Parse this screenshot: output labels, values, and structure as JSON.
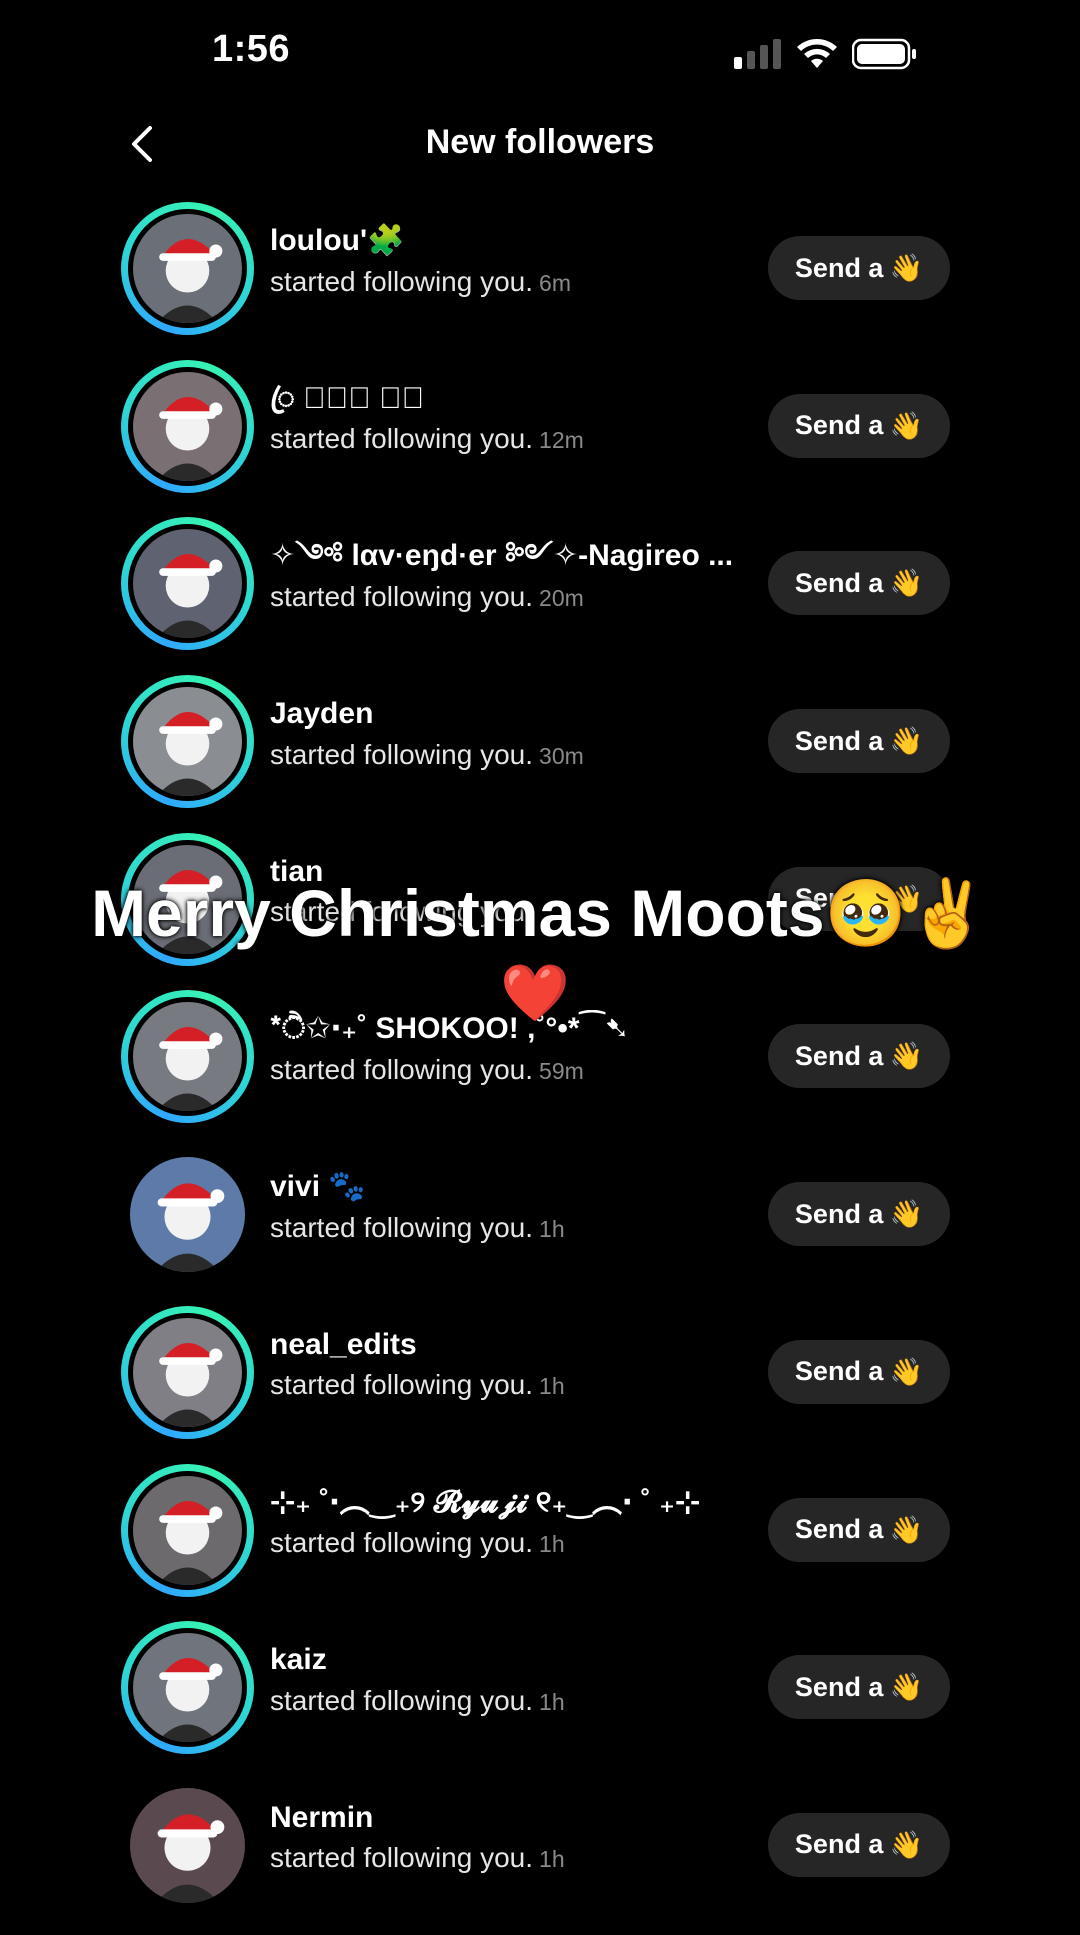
{
  "status_bar": {
    "time": "1:56",
    "icons": [
      "signal-icon",
      "wifi-icon",
      "battery-icon"
    ]
  },
  "nav": {
    "title": "New followers",
    "back_icon": "chevron-left-icon"
  },
  "send_label": "Send a",
  "send_emoji": "👋",
  "activity_text": "started following you.",
  "followers": [
    {
      "name": "loulou'🧩",
      "time": "6m",
      "story_ring": true
    },
    {
      "name": "ꦿ 𝓝𝓪𝓽 ⋆ꦿ",
      "time": "12m",
      "story_ring": true
    },
    {
      "name": "✧༺ lαv·eŋd·er ༻✧-Nagireo ...",
      "time": "20m",
      "story_ring": true
    },
    {
      "name": "Jayden",
      "time": "30m",
      "story_ring": true
    },
    {
      "name": "tian",
      "time": "",
      "story_ring": true
    },
    {
      "name": "*ੈ✩‧₊˚ SHOKOO! ,˚°•*⁀➷",
      "time": "59m",
      "story_ring": true
    },
    {
      "name": "vivi 🐾",
      "time": "1h",
      "story_ring": false
    },
    {
      "name": "neal_edits",
      "time": "1h",
      "story_ring": true
    },
    {
      "name": "⊹₊ ˚‧︵‿₊୨ 𝓡𝔂𝓾𝓳𝓲 ୧₊‿︵‧ ˚ ₊⊹",
      "time": "1h",
      "story_ring": true
    },
    {
      "name": "kaiz",
      "time": "1h",
      "story_ring": true
    },
    {
      "name": "Nermin",
      "time": "1h",
      "story_ring": false
    }
  ],
  "overlay": {
    "caption": "Merry Christmas Moots🥹✌️",
    "heart": "❤️"
  },
  "colors": {
    "background": "#000000",
    "button_bg": "#262626",
    "ring_start": "#2fa8ff",
    "ring_end": "#37f3b3"
  }
}
